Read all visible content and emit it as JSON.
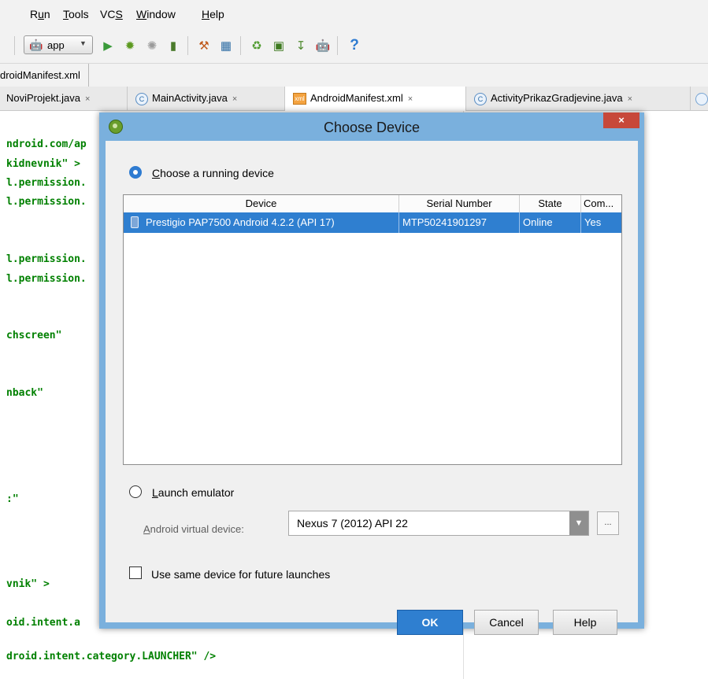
{
  "menubar": {
    "items": [
      {
        "pre": "R",
        "u": "u",
        "post": "n"
      },
      {
        "pre": "",
        "u": "T",
        "post": "ools"
      },
      {
        "pre": "VC",
        "u": "S",
        "post": ""
      },
      {
        "pre": "",
        "u": "W",
        "post": "indow"
      },
      {
        "pre": "",
        "u": "H",
        "post": "elp"
      }
    ]
  },
  "toolbar": {
    "app_label": "app",
    "help_glyph": "?"
  },
  "navbar": {
    "crumb": "droidManifest.xml"
  },
  "tabs": [
    {
      "label": "NoviProjekt.java",
      "close": "×"
    },
    {
      "icon": "C",
      "label": "MainActivity.java",
      "close": "×"
    },
    {
      "icon": "xml",
      "label": "AndroidManifest.xml",
      "close": "×"
    },
    {
      "icon": "C",
      "label": "ActivityPrikazGradjevine.java",
      "close": "×"
    }
  ],
  "code_lines": [
    "ndroid.com/ap",
    "kidnevnik\" >",
    "l.permission.",
    "l.permission.",
    "l.permission.",
    "l.permission.",
    "chscreen\"",
    "nback\"",
    ":\"",
    "vnik\" >",
    "oid.intent.a",
    "droid.intent.category.LAUNCHER\" />"
  ],
  "dialog": {
    "title": "Choose Device",
    "close_glyph": "×",
    "running_option": {
      "u": "C",
      "rest": "hoose a running device",
      "selected": true
    },
    "table": {
      "headers": [
        "Device",
        "Serial Number",
        "State",
        "Com..."
      ],
      "rows": [
        {
          "device": "Prestigio PAP7500 Android 4.2.2 (API 17)",
          "serial": "MTP50241901297",
          "state": "Online",
          "compatible": "Yes"
        }
      ]
    },
    "emulator_option": {
      "u": "L",
      "rest": "aunch emulator",
      "selected": false
    },
    "avd": {
      "label_u": "A",
      "label_rest": "ndroid virtual device:",
      "value": "Nexus 7 (2012) API 22",
      "more": "..."
    },
    "same_device": {
      "label": "Use same device for future launches",
      "checked": false
    },
    "buttons": {
      "ok": "OK",
      "cancel": "Cancel",
      "help": "Help"
    },
    "colors": {
      "selection": "#2f7fd0",
      "close": "#c7483a",
      "frame": "#7ab0dd"
    }
  }
}
